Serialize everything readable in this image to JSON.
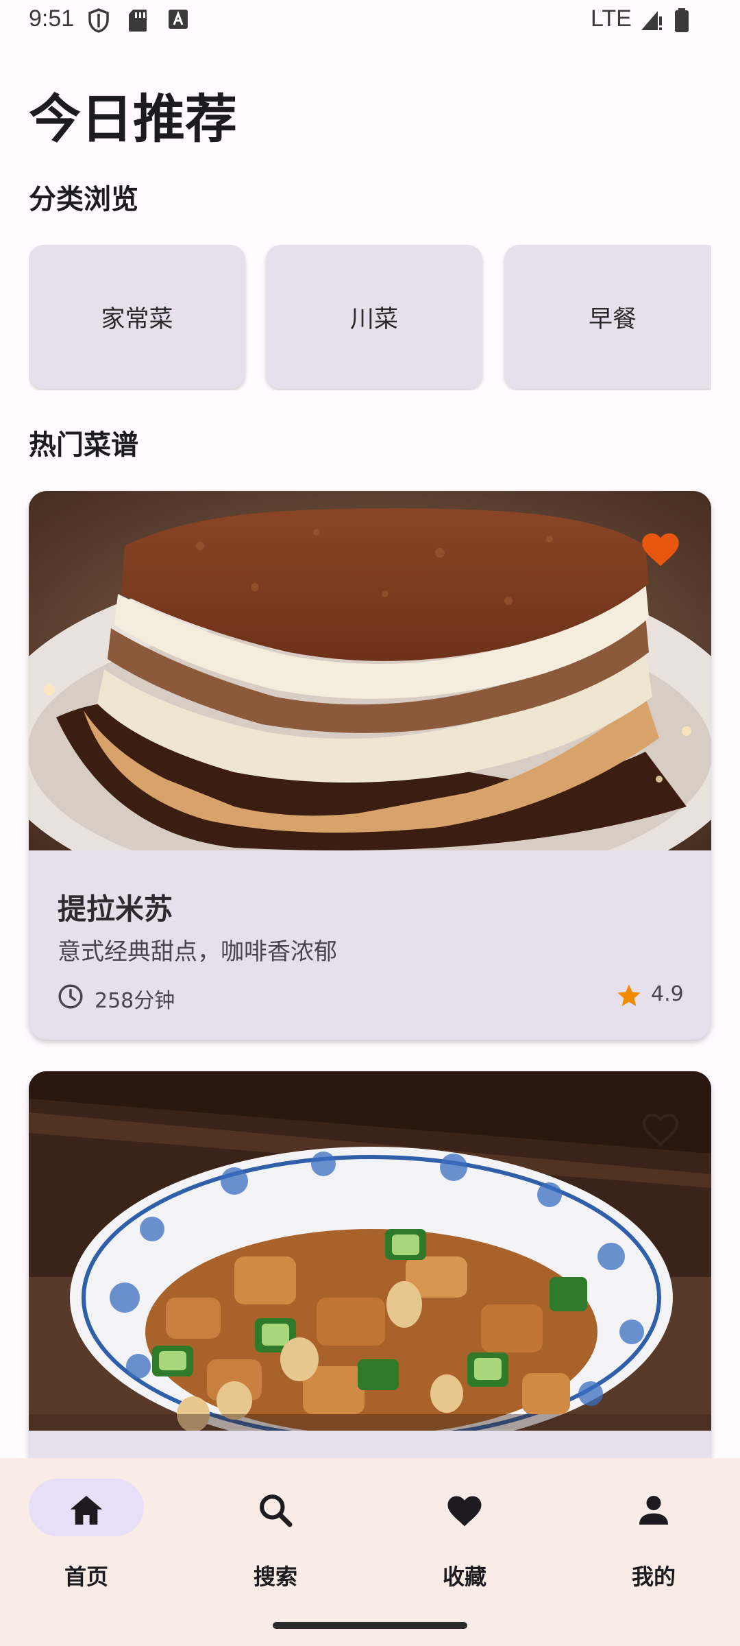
{
  "status_bar": {
    "time": "9:51",
    "network": "LTE"
  },
  "page_title": "今日推荐",
  "categories_section": {
    "title": "分类浏览",
    "items": [
      {
        "label": "家常菜"
      },
      {
        "label": "川菜"
      },
      {
        "label": "早餐"
      }
    ]
  },
  "popular_section": {
    "title": "热门菜谱",
    "recipes": [
      {
        "title": "提拉米苏",
        "description": "意式经典甜点，咖啡香浓郁",
        "time": "258分钟",
        "rating": "4.9",
        "favorited": true,
        "image": "tiramisu-photo"
      },
      {
        "title": "",
        "description": "",
        "time": "",
        "rating": "",
        "favorited": false,
        "image": "kung-pao-chicken-photo"
      }
    ]
  },
  "bottom_nav": {
    "items": [
      {
        "label": "首页",
        "icon": "home-icon",
        "active": true
      },
      {
        "label": "搜索",
        "icon": "search-icon",
        "active": false
      },
      {
        "label": "收藏",
        "icon": "heart-icon",
        "active": false
      },
      {
        "label": "我的",
        "icon": "person-icon",
        "active": false
      }
    ]
  },
  "colors": {
    "favorite_active": "#e8570f",
    "rating_star": "#f08c00",
    "nav_active_pill": "#e8def8",
    "card_bg": "#e6e0ec",
    "nav_bg": "#f9ebe6"
  }
}
